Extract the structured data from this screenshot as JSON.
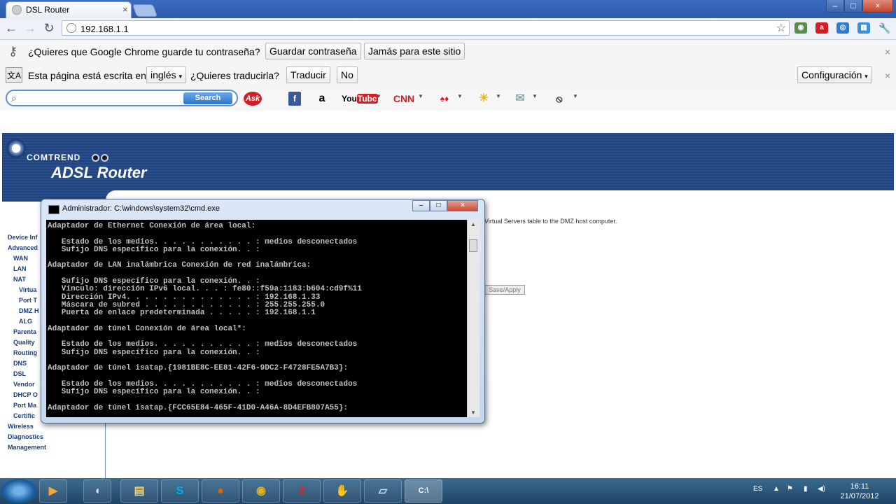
{
  "browser": {
    "tab_title": "DSL Router",
    "tab_close": "×",
    "url": "192.168.1.1",
    "window_buttons": [
      "–",
      "□",
      "×"
    ]
  },
  "password_bar": {
    "message": "¿Quieres que Google Chrome guarde tu contraseña?",
    "save_label": "Guardar contraseña",
    "never_label": "Jamás para este sitio",
    "close": "×"
  },
  "translate_bar": {
    "prefix": "Esta página está escrita en",
    "language": "inglés",
    "question": "¿Quieres traducirla?",
    "translate_label": "Traducir",
    "no_label": "No",
    "settings_label": "Configuración",
    "close": "×"
  },
  "ask_toolbar": {
    "search_label": "Search",
    "search_value": "",
    "icons": [
      "Ask",
      "f",
      "a",
      "YouTube",
      "CNN",
      "games",
      "weather",
      "mail",
      "radio"
    ]
  },
  "router": {
    "brand": "COMTREND",
    "product": "ADSL Router",
    "description": "Virtual Servers table to the DMZ host computer.",
    "save_apply": "Save/Apply",
    "sidebar": [
      {
        "label": "Device Inf",
        "indent": 0
      },
      {
        "label": "Advanced",
        "indent": 0
      },
      {
        "label": "WAN",
        "indent": 1
      },
      {
        "label": "LAN",
        "indent": 1
      },
      {
        "label": "NAT",
        "indent": 1
      },
      {
        "label": "Virtua",
        "indent": 2
      },
      {
        "label": "Port T",
        "indent": 2
      },
      {
        "label": "DMZ H",
        "indent": 2
      },
      {
        "label": "ALG",
        "indent": 2
      },
      {
        "label": "Parenta",
        "indent": 1
      },
      {
        "label": "Quality",
        "indent": 1
      },
      {
        "label": "Routing",
        "indent": 1
      },
      {
        "label": "DNS",
        "indent": 1
      },
      {
        "label": "DSL",
        "indent": 1
      },
      {
        "label": "Vendor",
        "indent": 1
      },
      {
        "label": "DHCP O",
        "indent": 1
      },
      {
        "label": "Port Ma",
        "indent": 1
      },
      {
        "label": "Certific",
        "indent": 1
      },
      {
        "label": "Wireless",
        "indent": 0
      },
      {
        "label": "Diagnostics",
        "indent": 0
      },
      {
        "label": "Management",
        "indent": 0
      }
    ]
  },
  "cmd": {
    "title": "Administrador: C:\\windows\\system32\\cmd.exe",
    "lines": [
      "Adaptador de Ethernet Conexión de área local:",
      "",
      "   Estado de los medios. . . . . . . . . . . : medios desconectados",
      "   Sufijo DNS específico para la conexión. . :",
      "",
      "Adaptador de LAN inalámbrica Conexión de red inalámbrica:",
      "",
      "   Sufijo DNS específico para la conexión. . :",
      "   Vínculo: dirección IPv6 local. . . : fe80::f59a:1183:b604:cd9f%11",
      "   Dirección IPv4. . . . . . . . . . . . . . : 192.168.1.33",
      "   Máscara de subred . . . . . . . . . . . . : 255.255.255.0",
      "   Puerta de enlace predeterminada . . . . . : 192.168.1.1",
      "",
      "Adaptador de túnel Conexión de área local*:",
      "",
      "   Estado de los medios. . . . . . . . . . . : medios desconectados",
      "   Sufijo DNS específico para la conexión. . :",
      "",
      "Adaptador de túnel isatap.{1981BE8C-EE81-42F6-9DC2-F4728FE5A7B3}:",
      "",
      "   Estado de los medios. . . . . . . . . . . : medios desconectados",
      "   Sufijo DNS específico para la conexión. . :",
      "",
      "Adaptador de túnel isatap.{FCC65E84-465F-41D0-A46A-8D4EFB807A55}:"
    ]
  },
  "taskbar": {
    "language": "ES",
    "time": "16:11",
    "date": "21/07/2012",
    "apps": [
      "media-player",
      "winamp",
      "explorer",
      "skype",
      "firefox",
      "chrome",
      "app-2",
      "glove",
      "notepad",
      "cmd"
    ]
  },
  "colors": {
    "router_blue": "#1d3e77",
    "taskbar": "#1f4466",
    "cmd_bg": "#000000",
    "cmd_fg": "#c0c0c0"
  }
}
